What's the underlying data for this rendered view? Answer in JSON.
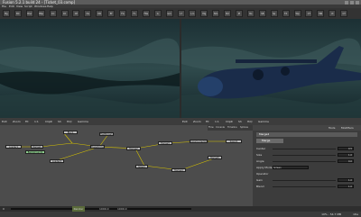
{
  "window": {
    "title": "Fusion 5.2.1 build 24 - [Ticket_03.comp]"
  },
  "menu": {
    "items": [
      "File",
      "Edit",
      "View",
      "Script",
      "Windows",
      "Help"
    ]
  },
  "toolbar": {
    "buttons": [
      "Bg",
      "BC",
      "Blur",
      "BSp",
      "CC",
      "Ch",
      "CP",
      "Ds",
      "DR",
      "Ef",
      "FG",
      "FL",
      "FSG",
      "G",
      "Gm",
      "Lf",
      "Lrn",
      "Mg",
      "Nm",
      "Nd",
      "Pl",
      "Rs",
      "SB",
      "Sp",
      "TX",
      "Wp",
      "CT",
      "MR",
      "VI",
      "CT"
    ]
  },
  "viewer_left": {
    "label": "Left View"
  },
  "viewer_right": {
    "label": "Right View"
  },
  "viewer_bar_left": {
    "items": [
      "Exit",
      "Zoom",
      "Fit",
      "1:1",
      "ClipR",
      "Sh",
      "HiQ",
      "Gamma"
    ]
  },
  "viewer_bar_right": {
    "items": [
      "Exit",
      "Zoom",
      "Fit",
      "1:1",
      "ClipR",
      "Sh",
      "HiQ",
      "Gamma"
    ]
  },
  "flow": {
    "tabs": [
      "Flow",
      "Console",
      "Timeline",
      "Splines"
    ],
    "nodes": [
      "Loader1",
      "Merge1",
      "Blur1",
      "Background1",
      "Transform1",
      "Merge2",
      "Merge3",
      "ColorCorrector1",
      "Saver1",
      "FastNoise1",
      "Merge4",
      "Merge5",
      "Glow1",
      "Loader2"
    ]
  },
  "tools": {
    "header": "Tools",
    "modifiers": "Modifiers",
    "node": "Merge2",
    "tab": "Merge",
    "controls": [
      {
        "label": "Center",
        "value": "0.5"
      },
      {
        "label": "Size",
        "value": "1.0"
      },
      {
        "label": "Angle",
        "value": "0.0"
      },
      {
        "label": "Apply Mode",
        "value": "Screen"
      },
      {
        "label": "Operator",
        "value": ""
      },
      {
        "label": "Gain",
        "value": "1.0"
      },
      {
        "label": "Blend",
        "value": "1.0"
      }
    ]
  },
  "timeline": {
    "start": "0",
    "end": "1000.0",
    "current": "1000.0",
    "render": "Render"
  },
  "status": {
    "left": "",
    "right": "10% - 54.7 MB",
    "time": "Idle"
  },
  "colors": {
    "accent": "#d8c400",
    "viewer_bg": "#14262a"
  }
}
